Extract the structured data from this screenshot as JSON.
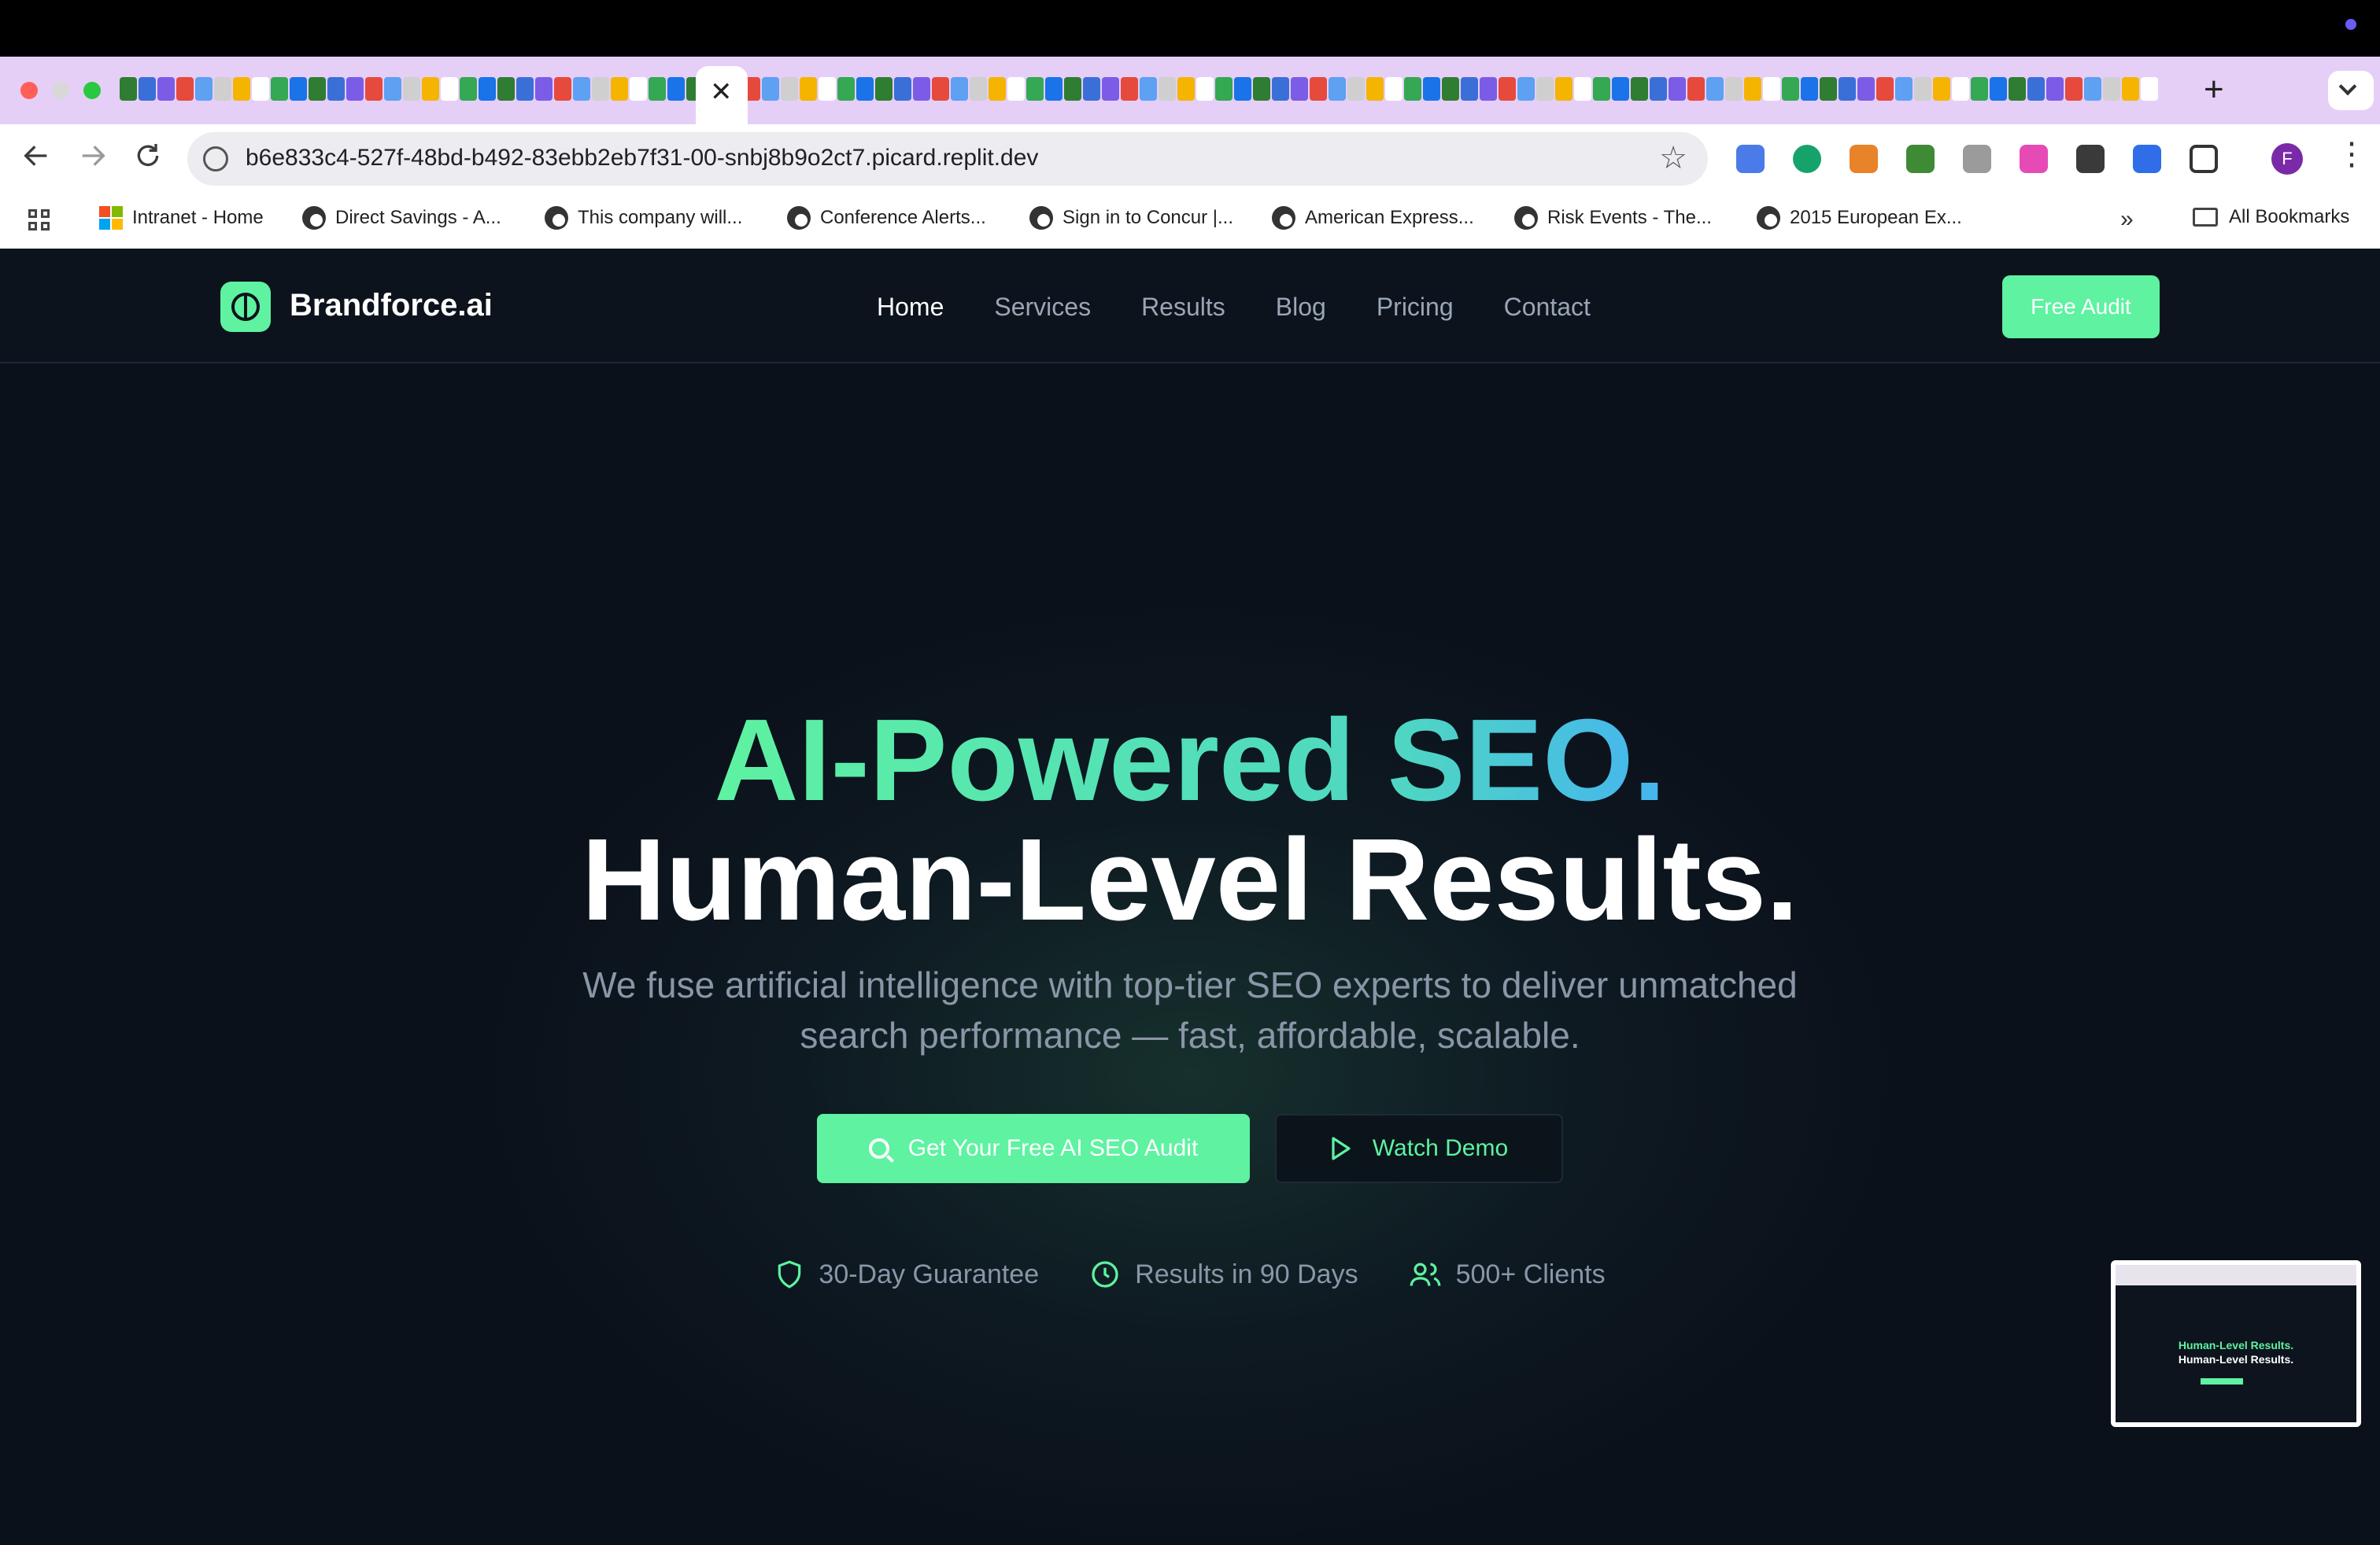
{
  "browser": {
    "tab_close_glyph": "✕",
    "new_tab_glyph": "+",
    "url": "b6e833c4-527f-48bd-b492-83ebb2eb7f31-00-snbj8b9o2ct7.picard.replit.dev",
    "profile_initial": "F",
    "bookmarks": [
      {
        "label": "Intranet - Home",
        "icon": "microsoft-icon"
      },
      {
        "label": "Direct Savings - A...",
        "icon": "globe-icon"
      },
      {
        "label": "This company will...",
        "icon": "globe-icon"
      },
      {
        "label": "Conference Alerts...",
        "icon": "globe-icon"
      },
      {
        "label": "Sign in to Concur |...",
        "icon": "globe-icon"
      },
      {
        "label": "American Express...",
        "icon": "globe-icon"
      },
      {
        "label": "Risk Events - The...",
        "icon": "globe-icon"
      },
      {
        "label": "2015 European Ex...",
        "icon": "globe-icon"
      }
    ],
    "bookmarks_more": "»",
    "all_bookmarks": "All Bookmarks"
  },
  "site": {
    "brand": "Brandforce.ai",
    "nav": [
      "Home",
      "Services",
      "Results",
      "Blog",
      "Pricing",
      "Contact"
    ],
    "active_nav": "Home",
    "audit_button": "Free Audit",
    "hero": {
      "line1_part1": "AI-Powered",
      "line1_part2": "SEO.",
      "line2": "Human-Level Results.",
      "subtitle": "We fuse artificial intelligence with top-tier SEO experts to deliver unmatched search performance — fast, affordable, scalable."
    },
    "cta_primary": "Get Your Free AI SEO Audit",
    "cta_secondary": "Watch Demo",
    "badges": [
      {
        "label": "30-Day Guarantee",
        "icon": "shield-icon"
      },
      {
        "label": "Results in 90 Days",
        "icon": "clock-icon"
      },
      {
        "label": "500+ Clients",
        "icon": "users-icon"
      }
    ]
  },
  "preview": {
    "line1": "Human-Level Results.",
    "line2": "Human-Level Results."
  },
  "colors": {
    "accent": "#5ef2a1",
    "gradient_end": "#45b4f0",
    "background": "#0b111b",
    "tabstrip": "#e5cff7"
  }
}
